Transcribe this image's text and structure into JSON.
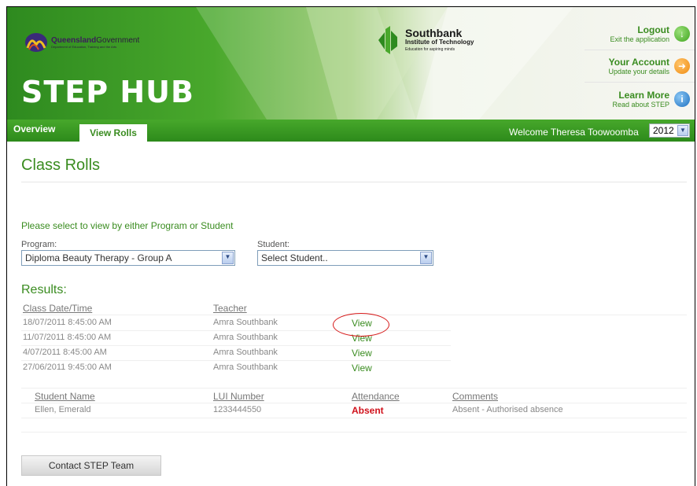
{
  "header": {
    "qld_logo_main_bold": "Queensland",
    "qld_logo_main": "Government",
    "qld_logo_sub": "Department of Education, Training and the Arts",
    "app_title": "STEP HUB",
    "southbank_name": "Southbank",
    "southbank_institute": "Institute of Technology",
    "southbank_tagline": "Education for aspiring minds",
    "links": [
      {
        "title": "Logout",
        "subtitle": "Exit the application",
        "icon": "down-arrow-icon",
        "color": "#3fa51e"
      },
      {
        "title": "Your Account",
        "subtitle": "Update your details",
        "icon": "right-arrow-icon",
        "color": "#f08c12"
      },
      {
        "title": "Learn More",
        "subtitle": "Read about STEP",
        "icon": "info-icon",
        "color": "#1c6fc0"
      }
    ]
  },
  "nav": {
    "tabs": [
      "Overview",
      "View Rolls"
    ],
    "active_tab": "View Rolls",
    "welcome": "Welcome Theresa Toowoomba",
    "year": "2012"
  },
  "main": {
    "title": "Class Rolls",
    "instruction": "Please select to view by either Program or Student",
    "program_label": "Program:",
    "program_value": "Diploma Beauty Therapy - Group A",
    "student_label": "Student:",
    "student_value": "Select Student..",
    "results_heading": "Results:",
    "classes": {
      "headers": [
        "Class Date/Time",
        "Teacher"
      ],
      "rows": [
        {
          "date": "18/07/2011 8:45:00 AM",
          "teacher": "Amra Southbank",
          "action": "View"
        },
        {
          "date": "11/07/2011 8:45:00 AM",
          "teacher": "Amra Southbank",
          "action": "View"
        },
        {
          "date": "4/07/2011 8:45:00 AM",
          "teacher": "Amra Southbank",
          "action": "View"
        },
        {
          "date": "27/06/2011 9:45:00 AM",
          "teacher": "Amra Southbank",
          "action": "View"
        }
      ]
    },
    "students": {
      "headers": [
        "Student Name",
        "LUI Number",
        "Attendance",
        "Comments"
      ],
      "rows": [
        {
          "name": "Ellen, Emerald",
          "lui": "1233444550",
          "attendance": "Absent",
          "comments": "Absent - Authorised absence"
        }
      ]
    },
    "contact_button": "Contact STEP Team"
  },
  "colors": {
    "brand_green": "#3a8c20",
    "absent_red": "#d0101a",
    "annotation_red": "#d61a1a"
  }
}
